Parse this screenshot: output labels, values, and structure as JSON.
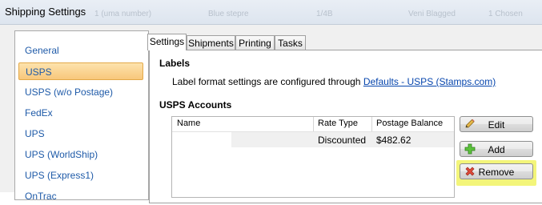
{
  "window": {
    "title": "Shipping Settings",
    "ghost_row": [
      "1 (uma number)",
      "Blue stepre",
      "1/4B",
      "Veni Blagged",
      "1 Chosen"
    ]
  },
  "sidebar": {
    "items": [
      {
        "label": "General",
        "selected": false
      },
      {
        "label": "USPS",
        "selected": true
      },
      {
        "label": "USPS (w/o Postage)",
        "selected": false
      },
      {
        "label": "FedEx",
        "selected": false
      },
      {
        "label": "UPS",
        "selected": false
      },
      {
        "label": "UPS (WorldShip)",
        "selected": false
      },
      {
        "label": "UPS (Express1)",
        "selected": false
      },
      {
        "label": "OnTrac",
        "selected": false
      }
    ]
  },
  "tabs": [
    {
      "label": "Settings",
      "active": true
    },
    {
      "label": "Shipments",
      "active": false
    },
    {
      "label": "Printing",
      "active": false
    },
    {
      "label": "Tasks",
      "active": false
    }
  ],
  "labels_section": {
    "title": "Labels",
    "description": "Label format settings are configured through",
    "link_text": "Defaults - USPS (Stamps.com)"
  },
  "accounts_section": {
    "title": "USPS Accounts",
    "columns": [
      "Name",
      "Rate Type",
      "Postage Balance"
    ],
    "rows": [
      {
        "name": "",
        "rate_type": "Discounted",
        "postage_balance": "$482.62"
      }
    ]
  },
  "buttons": {
    "edit": "Edit",
    "add": "Add",
    "remove": "Remove"
  },
  "colors": {
    "selection_fill": "#f8c77b",
    "link": "#0645ad",
    "add_highlight": "#f3f57a"
  }
}
